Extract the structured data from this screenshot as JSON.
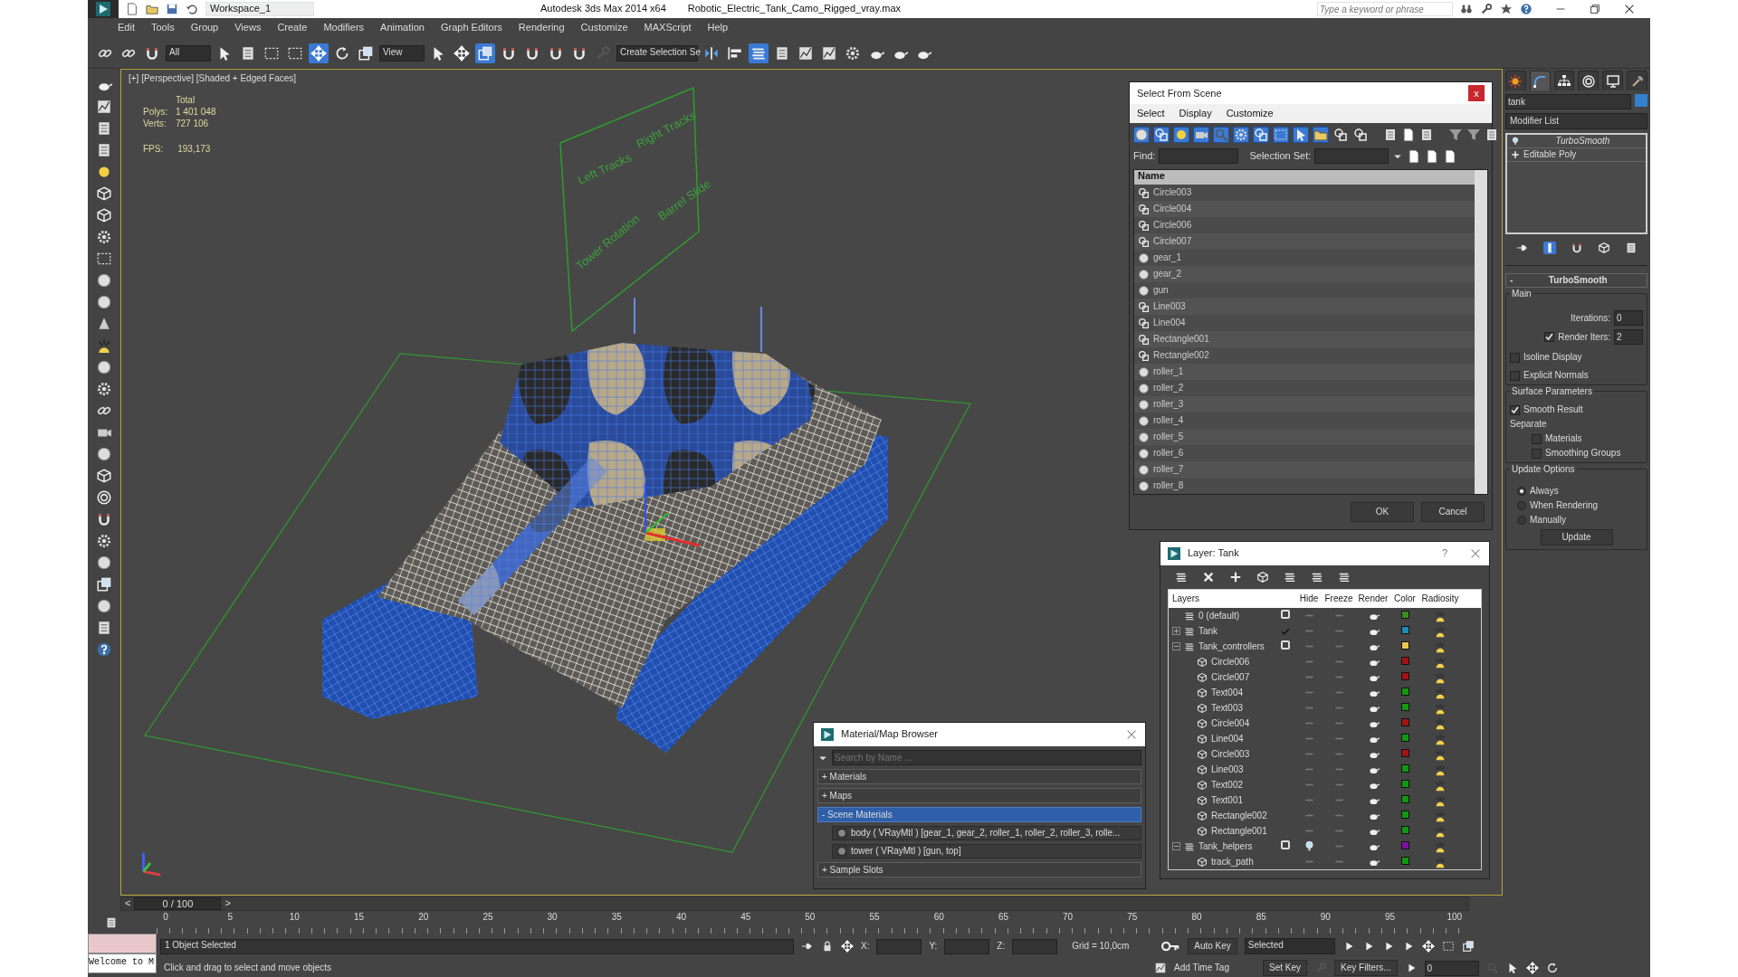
{
  "title_bar": {
    "workspace": "Workspace_1",
    "app": "Autodesk 3ds Max  2014 x64",
    "file": "Robotic_Electric_Tank_Camo_Rigged_vray.max",
    "search_placeholder": "Type a keyword or phrase"
  },
  "menu": [
    "Edit",
    "Tools",
    "Group",
    "Views",
    "Create",
    "Modifiers",
    "Animation",
    "Graph Editors",
    "Rendering",
    "Customize",
    "MAXScript",
    "Help"
  ],
  "main_toolbar": {
    "selection_filter": "All",
    "reference_coordinate": "View",
    "named_selection": "Create Selection Se"
  },
  "viewport": {
    "label": "[+] [Perspective] [Shaded + Edged Faces]",
    "stats_header": "Total",
    "stats": [
      {
        "label": "Polys:",
        "value": "1 401 048"
      },
      {
        "label": "Verts:",
        "value": "727 106"
      }
    ],
    "fps": {
      "label": "FPS:",
      "value": "193,173"
    },
    "scene_labels": [
      "Left Tracks",
      "Right Tracks",
      "Tower Rotation",
      "Barrel Slide"
    ]
  },
  "select_from_scene": {
    "title": "Select From Scene",
    "close": "x",
    "menu": [
      "Select",
      "Display",
      "Customize"
    ],
    "type_filters": [
      {
        "selected": true
      },
      {
        "selected": true
      },
      {
        "selected": true
      },
      {
        "selected": true
      },
      {
        "selected": true
      },
      {
        "selected": true
      },
      {
        "selected": true
      },
      {
        "selected": true
      },
      {
        "selected": true
      },
      {
        "selected": true
      },
      {
        "selected": false
      },
      {
        "selected": false
      }
    ],
    "find_label": "Find:",
    "selection_set_label": "Selection Set:",
    "column": "Name",
    "items": [
      {
        "name": "Circle003",
        "kind": "shape"
      },
      {
        "name": "Circle004",
        "kind": "shape"
      },
      {
        "name": "Circle006",
        "kind": "shape"
      },
      {
        "name": "Circle007",
        "kind": "shape"
      },
      {
        "name": "gear_1",
        "kind": "geometry"
      },
      {
        "name": "gear_2",
        "kind": "geometry"
      },
      {
        "name": "gun",
        "kind": "geometry"
      },
      {
        "name": "Line003",
        "kind": "shape"
      },
      {
        "name": "Line004",
        "kind": "shape"
      },
      {
        "name": "Rectangle001",
        "kind": "shape"
      },
      {
        "name": "Rectangle002",
        "kind": "shape"
      },
      {
        "name": "roller_1",
        "kind": "geometry"
      },
      {
        "name": "roller_2",
        "kind": "geometry"
      },
      {
        "name": "roller_3",
        "kind": "geometry"
      },
      {
        "name": "roller_4",
        "kind": "geometry"
      },
      {
        "name": "roller_5",
        "kind": "geometry"
      },
      {
        "name": "roller_6",
        "kind": "geometry"
      },
      {
        "name": "roller_7",
        "kind": "geometry"
      },
      {
        "name": "roller_8",
        "kind": "geometry"
      }
    ],
    "buttons": [
      "OK",
      "Cancel"
    ]
  },
  "command_panel": {
    "tabs": [
      {
        "selected": false
      },
      {
        "selected": true
      },
      {
        "selected": false
      },
      {
        "selected": false
      },
      {
        "selected": false
      },
      {
        "selected": false
      }
    ],
    "object_name": "tank",
    "modifier_list": "Modifier List",
    "stack": [
      {
        "name": "TurboSmooth",
        "kind": "modifier"
      },
      {
        "name": "Editable Poly",
        "kind": "base"
      }
    ],
    "rollout": {
      "toggle": "-",
      "title": "TurboSmooth",
      "main": {
        "title": "Main",
        "iterations_label": "Iterations:",
        "iterations": "0",
        "render_iters_label": "Render Iters:",
        "render_iters": "2",
        "render_iters_checked": true,
        "options": [
          {
            "label": "Isoline Display",
            "checked": false
          },
          {
            "label": "Explicit Normals",
            "checked": false
          }
        ]
      },
      "surface": {
        "title": "Surface Parameters",
        "smooth_result": {
          "label": "Smooth Result",
          "checked": true
        },
        "separate_label": "Separate",
        "separate": [
          {
            "label": "Materials",
            "checked": false
          },
          {
            "label": "Smoothing Groups",
            "checked": false
          }
        ]
      },
      "update": {
        "title": "Update Options",
        "options": [
          {
            "label": "Always",
            "selected": true
          },
          {
            "label": "When Rendering",
            "selected": false
          },
          {
            "label": "Manually",
            "selected": false
          }
        ],
        "button": "Update"
      }
    }
  },
  "layer_dialog": {
    "title": "Layer: Tank",
    "help": "?",
    "columns": [
      "Layers",
      "Hide",
      "Freeze",
      "Render",
      "Color",
      "Radiosity"
    ],
    "rows": [
      {
        "name": "0 (default)",
        "kind": "layer",
        "current": false,
        "hidden": false,
        "color": "#3c8c1e"
      },
      {
        "name": "Tank",
        "kind": "layer",
        "current": true,
        "expanded": false,
        "hidden": false,
        "color": "#1e8cb4"
      },
      {
        "name": "Tank_controllers",
        "kind": "layer",
        "current": false,
        "expanded": true,
        "hidden": false,
        "color": "#e6c850",
        "children": [
          {
            "name": "Circle006",
            "kind": "object",
            "hidden": false,
            "color": "#a01414"
          },
          {
            "name": "Circle007",
            "kind": "object",
            "hidden": false,
            "color": "#a01414"
          },
          {
            "name": "Text004",
            "kind": "object",
            "hidden": false,
            "color": "#149614"
          },
          {
            "name": "Text003",
            "kind": "object",
            "hidden": false,
            "color": "#149614"
          },
          {
            "name": "Circle004",
            "kind": "object",
            "hidden": false,
            "color": "#a01414"
          },
          {
            "name": "Line004",
            "kind": "object",
            "hidden": false,
            "color": "#149614"
          },
          {
            "name": "Circle003",
            "kind": "object",
            "hidden": false,
            "color": "#a01414"
          },
          {
            "name": "Line003",
            "kind": "object",
            "hidden": false,
            "color": "#149614"
          },
          {
            "name": "Text002",
            "kind": "object",
            "hidden": false,
            "color": "#149614"
          },
          {
            "name": "Text001",
            "kind": "object",
            "hidden": false,
            "color": "#149614"
          },
          {
            "name": "Rectangle002",
            "kind": "object",
            "hidden": false,
            "color": "#149614"
          },
          {
            "name": "Rectangle001",
            "kind": "object",
            "hidden": false,
            "color": "#149614"
          }
        ]
      },
      {
        "name": "Tank_helpers",
        "kind": "layer",
        "current": false,
        "expanded": true,
        "hidden": true,
        "color": "#7814a0",
        "children": [
          {
            "name": "track_path",
            "kind": "object",
            "hidden": false,
            "color": "#149614"
          }
        ]
      }
    ]
  },
  "material_browser": {
    "title": "Material/Map Browser",
    "search_placeholder": "Search by Name ...",
    "groups": [
      {
        "label": "+ Materials",
        "expanded": false
      },
      {
        "label": "+ Maps",
        "expanded": false
      },
      {
        "label": "- Scene Materials",
        "expanded": true,
        "items": [
          "body  ( VRayMtl ) [gear_1, gear_2, roller_1, roller_2, roller_3, rolle...",
          "tower  ( VRayMtl ) [gun, top]"
        ]
      },
      {
        "label": "+ Sample Slots",
        "expanded": false
      }
    ]
  },
  "timeline": {
    "prev": "<",
    "position": "0 / 100",
    "next": ">",
    "ticks": [
      "0",
      "5",
      "10",
      "15",
      "20",
      "25",
      "30",
      "35",
      "40",
      "45",
      "50",
      "55",
      "60",
      "65",
      "70",
      "75",
      "80",
      "85",
      "90",
      "95",
      "100"
    ]
  },
  "status_bar": {
    "listener": "Welcome to M",
    "selection": "1 Object Selected",
    "prompt": "Click and drag to select and move objects",
    "x_label": "X:",
    "y_label": "Y:",
    "z_label": "Z:",
    "grid": "Grid = 10,0cm",
    "add_time_tag": "Add Time Tag",
    "auto_key": "Auto Key",
    "set_key": "Set Key",
    "key_mode": "Selected",
    "key_filters": "Key Filters...",
    "frame": "0"
  }
}
